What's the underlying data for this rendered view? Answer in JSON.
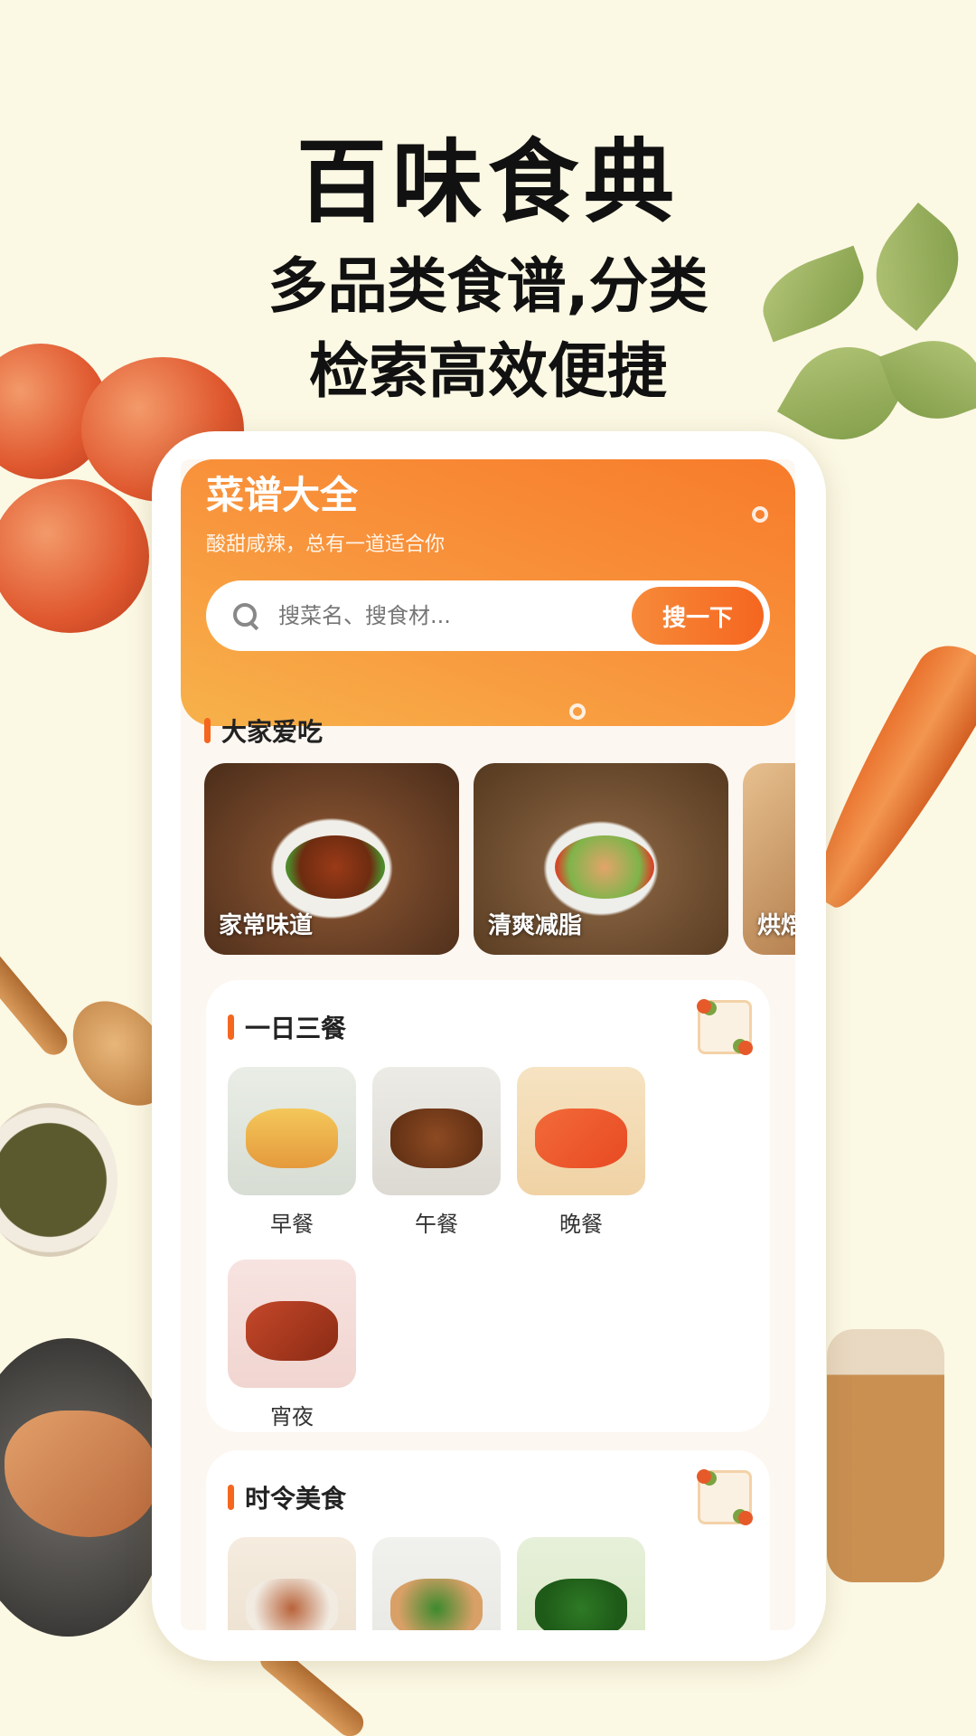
{
  "hero": {
    "title": "百味食典",
    "subtitle_line1": "多品类食谱,分类",
    "subtitle_line2": "检索高效便捷"
  },
  "banner": {
    "title": "菜谱大全",
    "subtitle": "酸甜咸辣，总有一道适合你"
  },
  "search": {
    "placeholder": "搜菜名、搜食材...",
    "button_label": "搜一下"
  },
  "popular": {
    "title": "大家爱吃",
    "cards": [
      {
        "label": "家常味道"
      },
      {
        "label": "清爽减脂"
      },
      {
        "label": "烘焙"
      }
    ]
  },
  "meals": {
    "title": "一日三餐",
    "items": [
      {
        "label": "早餐"
      },
      {
        "label": "午餐"
      },
      {
        "label": "晚餐"
      },
      {
        "label": "宵夜"
      }
    ]
  },
  "seasonal": {
    "title": "时令美食",
    "items": [
      {
        "label": ""
      },
      {
        "label": ""
      },
      {
        "label": ""
      }
    ]
  },
  "colors": {
    "background": "#fbf8e4",
    "accent": "#f5661f",
    "banner_gradient_start": "#f77b2a",
    "banner_gradient_end": "#f7b24a"
  }
}
